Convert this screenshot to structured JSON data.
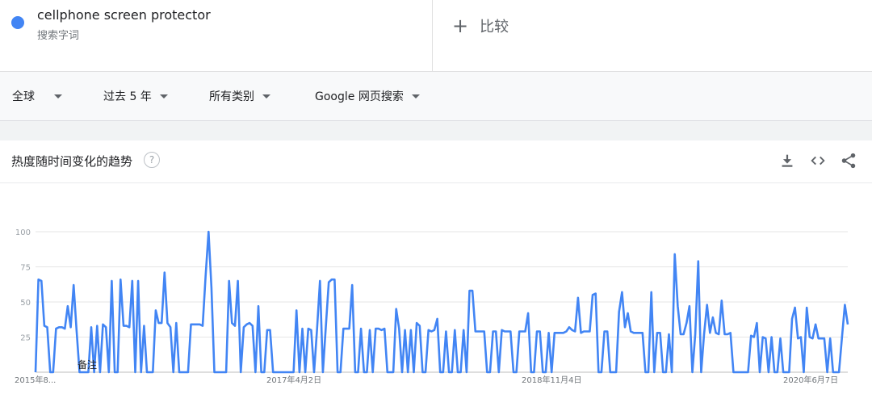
{
  "search": {
    "term": "cellphone screen protector",
    "term_type": "搜索字词",
    "term_color": "#4285f4",
    "compare_label": "比较",
    "compare_icon": "plus-icon"
  },
  "filters": {
    "region": "全球",
    "time": "过去 5 年",
    "category": "所有类别",
    "search_type": "Google 网页搜索"
  },
  "panel": {
    "title": "热度随时间变化的趋势",
    "help_icon": "help-circle-icon",
    "tools": [
      "download-icon",
      "embed-icon",
      "share-icon"
    ]
  },
  "chart_data": {
    "type": "line",
    "xlabel": "",
    "ylabel": "",
    "ylim": [
      0,
      100
    ],
    "yticks": [
      25,
      50,
      75,
      100
    ],
    "x_tick_labels": [
      "2015年8...",
      "2017年4月2日",
      "2018年11月4日",
      "2020年6月7日"
    ],
    "annotation": "备注",
    "grid": true,
    "series": [
      {
        "color": "#4285f4",
        "values": [
          0,
          66,
          65,
          33,
          32,
          0,
          0,
          31,
          32,
          32,
          31,
          47,
          32,
          62,
          30,
          0,
          0,
          0,
          0,
          32,
          0,
          33,
          0,
          34,
          32,
          0,
          65,
          0,
          0,
          66,
          33,
          33,
          32,
          65,
          0,
          65,
          0,
          33,
          0,
          0,
          0,
          44,
          35,
          35,
          71,
          35,
          32,
          0,
          35,
          0,
          0,
          0,
          0,
          34,
          34,
          34,
          34,
          33,
          68,
          100,
          60,
          0,
          0,
          0,
          0,
          0,
          65,
          35,
          33,
          65,
          0,
          32,
          34,
          35,
          33,
          0,
          47,
          0,
          0,
          30,
          30,
          0,
          0,
          0,
          0,
          0,
          0,
          0,
          0,
          44,
          0,
          31,
          0,
          31,
          30,
          0,
          30,
          65,
          0,
          32,
          64,
          66,
          66,
          0,
          0,
          31,
          31,
          31,
          62,
          0,
          0,
          31,
          0,
          0,
          30,
          0,
          31,
          31,
          30,
          31,
          0,
          0,
          0,
          45,
          31,
          0,
          30,
          0,
          30,
          0,
          35,
          33,
          0,
          0,
          30,
          29,
          30,
          38,
          0,
          0,
          29,
          0,
          0,
          30,
          0,
          0,
          30,
          0,
          58,
          58,
          29,
          29,
          29,
          29,
          0,
          0,
          29,
          29,
          0,
          30,
          29,
          29,
          29,
          0,
          0,
          29,
          29,
          29,
          42,
          0,
          0,
          29,
          29,
          0,
          0,
          28,
          0,
          28,
          28,
          28,
          28,
          29,
          32,
          30,
          29,
          53,
          28,
          29,
          29,
          29,
          55,
          56,
          0,
          0,
          29,
          29,
          0,
          0,
          0,
          43,
          57,
          32,
          42,
          29,
          28,
          28,
          28,
          28,
          0,
          0,
          57,
          0,
          28,
          28,
          0,
          0,
          27,
          0,
          84,
          47,
          27,
          27,
          35,
          47,
          0,
          27,
          79,
          0,
          27,
          48,
          28,
          39,
          28,
          27,
          51,
          27,
          27,
          28,
          0,
          0,
          0,
          0,
          0,
          0,
          26,
          25,
          35,
          0,
          25,
          24,
          0,
          25,
          0,
          0,
          24,
          0,
          0,
          0,
          38,
          46,
          24,
          25,
          0,
          46,
          25,
          24,
          34,
          24,
          24,
          24,
          0,
          24,
          0,
          0,
          0,
          24,
          48,
          34
        ]
      }
    ]
  }
}
